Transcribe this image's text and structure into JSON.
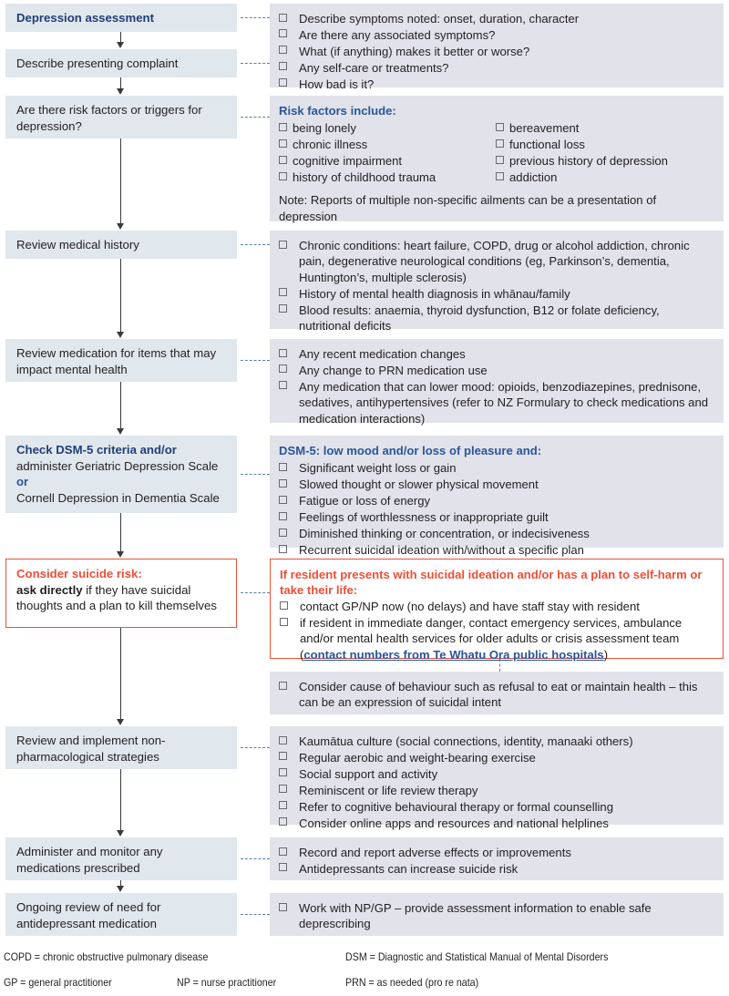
{
  "flow": {
    "steps": [
      {
        "id": "depression-assessment",
        "label": "Depression assessment",
        "style": "header"
      },
      {
        "id": "describe-presenting-complaint",
        "label": "Describe presenting complaint",
        "style": "plain"
      },
      {
        "id": "risk-factors-triggers",
        "label": "Are there risk factors or triggers for depression?",
        "style": "plain"
      },
      {
        "id": "review-medical-history",
        "label": "Review medical history",
        "style": "plain"
      },
      {
        "id": "review-medication",
        "label": "Review medication for items that may impact mental health",
        "style": "plain"
      },
      {
        "id": "check-dsm5",
        "label_bold": "Check DSM-5 criteria and/or",
        "label_rest_1": "administer Geriatric Depression Scale ",
        "label_or": "or",
        "label_rest_2": "Cornell Depression in Dementia Scale",
        "style": "header-multi"
      },
      {
        "id": "consider-suicide-risk",
        "label_bold": "Consider suicide risk:",
        "label_emph": "ask directly",
        "label_rest": " if they have suicidal thoughts and a plan to kill themselves",
        "style": "alert"
      },
      {
        "id": "non-pharmacological-strategies",
        "label": "Review and implement non-pharmacological strategies",
        "style": "plain"
      },
      {
        "id": "administer-monitor-medications",
        "label": "Administer and monitor any medications prescribed",
        "style": "plain"
      },
      {
        "id": "ongoing-review-antidepressant",
        "label": "Ongoing review of need for antidepressant medication",
        "style": "plain"
      }
    ]
  },
  "details": {
    "presenting_complaint": {
      "items": [
        "Describe symptoms noted: onset, duration, character",
        "Are there any associated symptoms?",
        "What (if anything) makes it better or worse?",
        "Any self-care or treatments?",
        "How bad is it?"
      ]
    },
    "risk_factors": {
      "heading": "Risk factors include:",
      "column_1": [
        "being lonely",
        "chronic illness",
        "cognitive impairment",
        "history of childhood trauma"
      ],
      "column_2": [
        "bereavement",
        "functional loss",
        "previous history of depression",
        "addiction"
      ],
      "note": "Note: Reports of multiple non-specific ailments can be a presentation of depression"
    },
    "medical_history": {
      "items": [
        "Chronic conditions: heart failure, COPD, drug or alcohol addiction, chronic pain, degenerative neurological conditions (eg, Parkinson’s, dementia, Huntington’s, multiple sclerosis)",
        "History of mental health diagnosis in whānau/family",
        "Blood results: anaemia, thyroid dysfunction, B12 or folate deficiency, nutritional deficits"
      ]
    },
    "medication_review": {
      "items": [
        "Any recent medication changes",
        "Any change to PRN medication use",
        "Any medication that can lower mood: opioids, benzodiazepines, prednisone, sedatives, antihypertensives (refer to NZ Formulary to check medications and medication interactions)"
      ]
    },
    "dsm5": {
      "heading": "DSM-5: low mood and/or loss of pleasure and:",
      "items": [
        "Significant weight loss or gain",
        "Slowed thought or slower physical movement",
        "Fatigue or loss of energy",
        "Feelings of worthlessness or inappropriate guilt",
        "Diminished thinking or concentration, or indecisiveness",
        "Recurrent suicidal ideation with/without a specific plan"
      ]
    },
    "suicide_plan": {
      "heading": "If resident presents with suicidal ideation and/or has a plan to self-harm or take their life:",
      "item_1": "contact GP/NP now (no delays) and have staff stay with resident",
      "item_2_before": "if resident in immediate danger, contact emergency services, ambulance and/or mental health services for older adults or crisis assessment team (",
      "item_2_link": "contact numbers from Te Whatu Ora public hospitals",
      "item_2_after": ")"
    },
    "behaviour_cause": {
      "items": [
        "Consider cause of behaviour such as refusal to eat or maintain health – this can be an expression of suicidal intent"
      ]
    },
    "non_pharmacological": {
      "items": [
        "Kaumātua culture (social connections, identity, manaaki others)",
        "Regular aerobic and weight-bearing exercise",
        "Social support and activity",
        "Reminiscent or life review therapy",
        "Refer to cognitive behavioural therapy or formal counselling",
        "Consider online apps and resources and national helplines"
      ]
    },
    "monitoring": {
      "items": [
        "Record and report adverse effects or improvements",
        "Antidepressants can increase suicide risk"
      ]
    },
    "ongoing_review": {
      "items": [
        "Work with NP/GP – provide assessment information to enable safe deprescribing"
      ]
    }
  },
  "legend": {
    "copd": "COPD = chronic obstructive pulmonary disease",
    "dsm": "DSM = Diagnostic and Statistical Manual of Mental Disorders",
    "gp": "GP = general practitioner",
    "np": "NP = nurse practitioner",
    "prn": "PRN = as needed (pro re nata)"
  },
  "colors": {
    "left_box_bg": "#e0e7ed",
    "right_box_bg": "#e2e2ea",
    "header_blue": "#1f3f76",
    "accent_blue": "#2a5699",
    "alert_red": "#f04e37",
    "connector_blue": "#5d7fa8",
    "arrow_gray": "#3a3a3a"
  }
}
